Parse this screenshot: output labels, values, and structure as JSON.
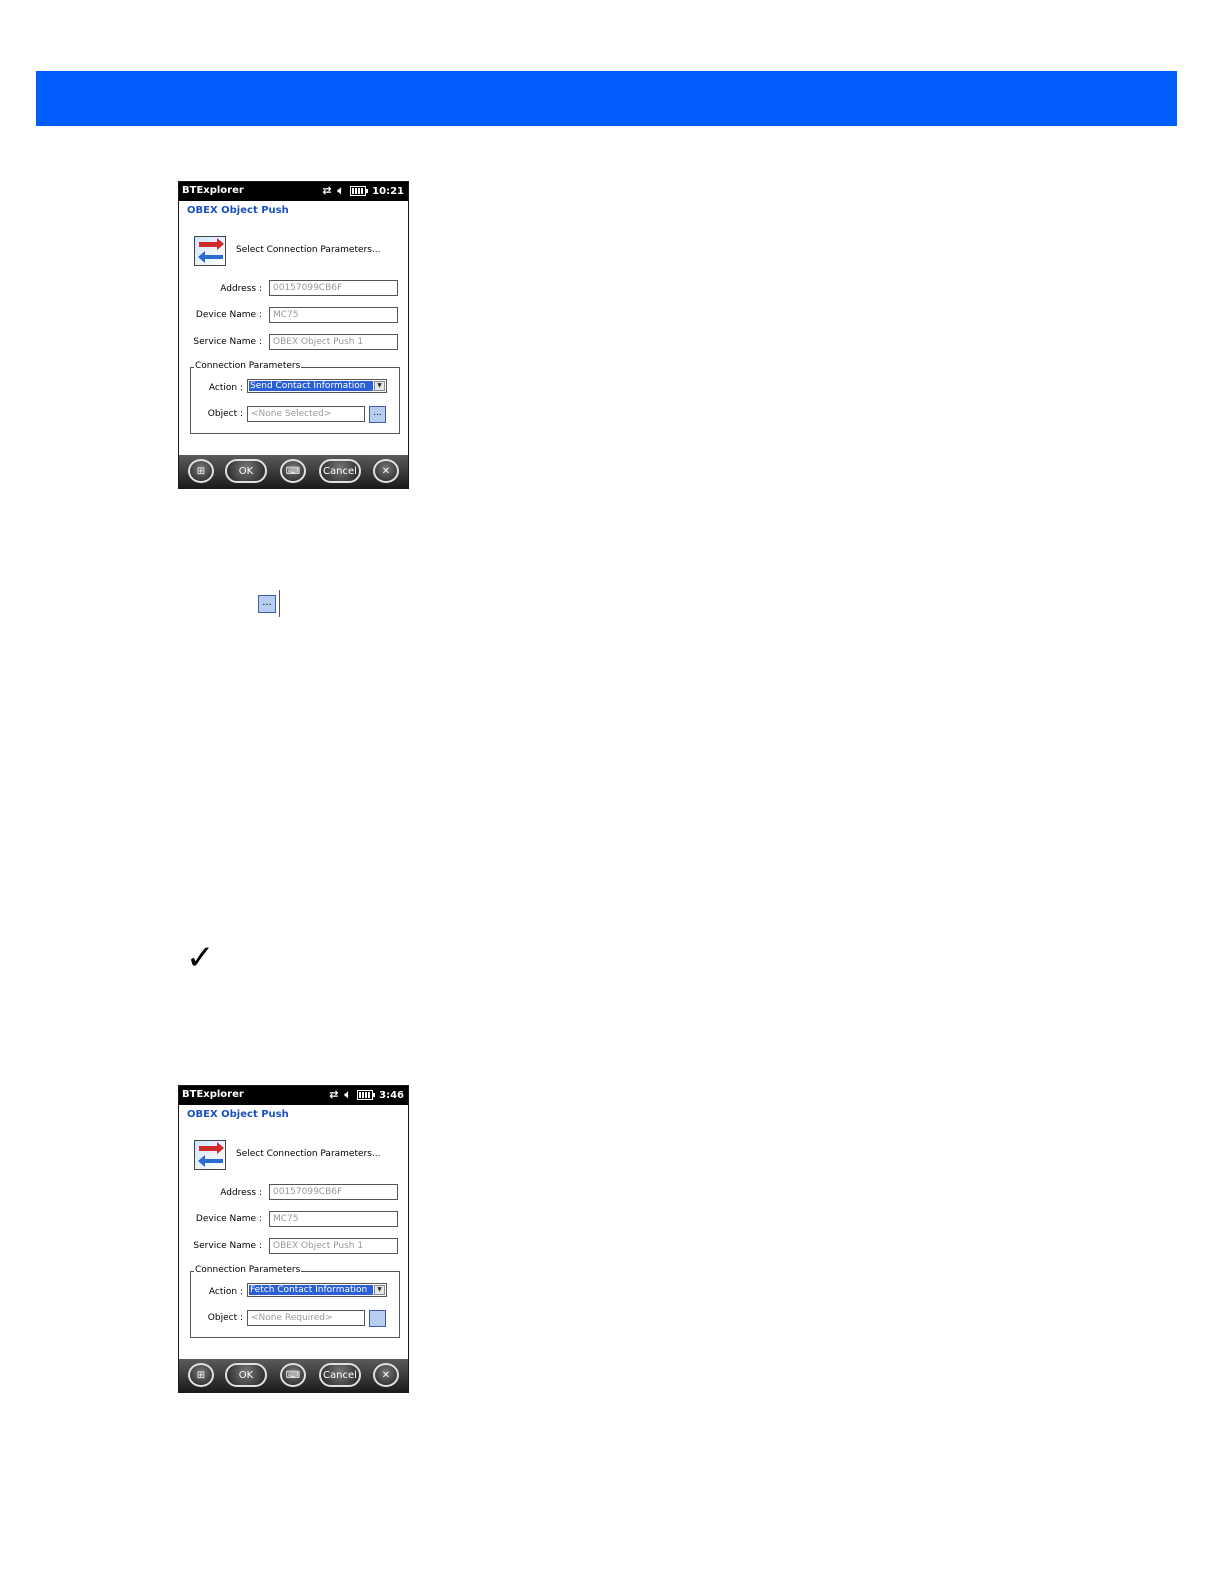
{
  "screens": [
    {
      "status": {
        "app": "BTExplorer",
        "time": "10:21"
      },
      "subtitle": "OBEX Object Push",
      "header_text": "Select Connection Parameters...",
      "address_label": "Address :",
      "address_value": "00157099CB6F",
      "device_name_label": "Device Name :",
      "device_name_value": "MC75",
      "service_name_label": "Service Name :",
      "service_name_value": "OBEX Object Push 1",
      "group_title": "Connection Parameters",
      "action_label": "Action :",
      "action_value": "Send Contact Information",
      "object_label": "Object :",
      "object_value": "<None Selected>",
      "browse_label": "...",
      "taskbar": {
        "ok": "OK",
        "cancel": "Cancel"
      }
    },
    {
      "status": {
        "app": "BTExplorer",
        "time": "3:46"
      },
      "subtitle": "OBEX Object Push",
      "header_text": "Select Connection Parameters...",
      "address_label": "Address :",
      "address_value": "00157099CB6F",
      "device_name_label": "Device Name :",
      "device_name_value": "MC75",
      "service_name_label": "Service Name :",
      "service_name_value": "OBEX Object Push 1",
      "group_title": "Connection Parameters",
      "action_label": "Action :",
      "action_value": "Fetch Contact Information",
      "object_label": "Object :",
      "object_value": "<None Required>",
      "browse_label": "",
      "taskbar": {
        "ok": "OK",
        "cancel": "Cancel"
      }
    }
  ],
  "inline_browse_label": "...",
  "icons": [
    "windows-start-icon",
    "keyboard-icon",
    "close-icon",
    "sync-icon",
    "speaker-icon",
    "battery-icon",
    "checkmark-icon",
    "connection-wizard-icon"
  ],
  "colors": {
    "banner": "#005eff",
    "subtitle": "#1e4fc0",
    "selection": "#2a5fd6",
    "browse": "#b7cdf2"
  }
}
